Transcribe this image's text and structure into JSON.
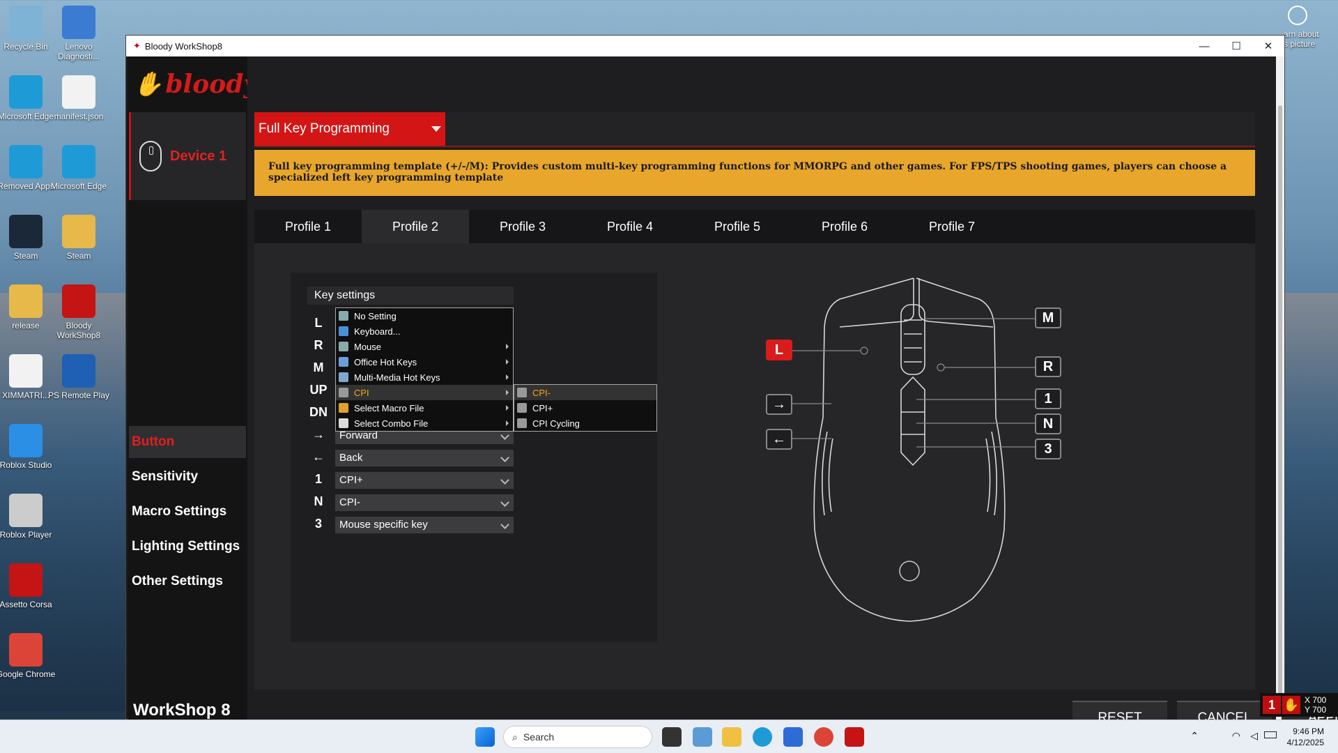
{
  "desktop": {
    "icons": [
      {
        "label": "Recycle Bin",
        "color": "#7fb3d6"
      },
      {
        "label": "Lenovo Diagnosti...",
        "color": "#3b7bd1"
      },
      {
        "label": "Microsoft Edge",
        "color": "#1e9bd7"
      },
      {
        "label": "manifest.json",
        "color": "#f2f2f2"
      },
      {
        "label": "Removed Apps",
        "color": "#1e9bd7"
      },
      {
        "label": "Microsoft Edge",
        "color": "#1e9bd7"
      },
      {
        "label": "Steam",
        "color": "#1b2838"
      },
      {
        "label": "Steam",
        "color": "#e6b94a"
      },
      {
        "label": "release",
        "color": "#e6b94a"
      },
      {
        "label": "Bloody WorkShop8",
        "color": "#c41414"
      },
      {
        "label": "XIMMATRI...",
        "color": "#f2f2f2"
      },
      {
        "label": "PS Remote Play",
        "color": "#1f5fb4"
      },
      {
        "label": "Roblox Studio",
        "color": "#2b8fe6"
      },
      {
        "label": "Roblox Player",
        "color": "#cccccc"
      },
      {
        "label": "Assetto Corsa",
        "color": "#c41414"
      },
      {
        "label": "Google Chrome",
        "color": "#db4437"
      }
    ],
    "learn_about": "arn about\ns picture"
  },
  "window": {
    "title": "Bloody WorkShop8",
    "min": "—",
    "max": "☐",
    "close": "✕"
  },
  "sidebar": {
    "logo": "bloody",
    "device": "Device 1",
    "nav": [
      {
        "label": "Button",
        "active": true
      },
      {
        "label": "Sensitivity",
        "active": false
      },
      {
        "label": "Macro Settings",
        "active": false
      },
      {
        "label": "Lighting Settings",
        "active": false
      },
      {
        "label": "Other Settings",
        "active": false
      }
    ],
    "footer": "WorkShop 8"
  },
  "mode": {
    "selected": "Full Key Programming",
    "notice": "Full key programming template (+/-/M): Provides custom multi-key programming functions for MMORPG and other games.  For FPS/TPS shooting games, players can choose a specialized left key programming template"
  },
  "profiles": [
    "Profile 1",
    "Profile 2",
    "Profile 3",
    "Profile 4",
    "Profile 5",
    "Profile 6",
    "Profile 7"
  ],
  "active_profile": "Profile 2",
  "key_settings": {
    "header": "Key settings",
    "rows": [
      {
        "key": "L",
        "value": ""
      },
      {
        "key": "R",
        "value": ""
      },
      {
        "key": "M",
        "value": ""
      },
      {
        "key": "UP",
        "value": ""
      },
      {
        "key": "DN",
        "value": ""
      },
      {
        "key": "→",
        "value": "Forward"
      },
      {
        "key": "←",
        "value": "Back"
      },
      {
        "key": "1",
        "value": "CPI+"
      },
      {
        "key": "N",
        "value": "CPI-"
      },
      {
        "key": "3",
        "value": "Mouse specific key"
      }
    ]
  },
  "context_menu": {
    "items": [
      {
        "label": "No Setting",
        "submenu": false
      },
      {
        "label": "Keyboard...",
        "submenu": false
      },
      {
        "label": "Mouse",
        "submenu": true
      },
      {
        "label": "Office Hot Keys",
        "submenu": true
      },
      {
        "label": "Multi-Media Hot Keys",
        "submenu": true
      },
      {
        "label": "CPI",
        "submenu": true,
        "highlight": true
      },
      {
        "label": "Select Macro File",
        "submenu": true
      },
      {
        "label": "Select Combo File",
        "submenu": true
      }
    ],
    "submenu": [
      {
        "label": "CPI-",
        "highlight": true
      },
      {
        "label": "CPI+"
      },
      {
        "label": "CPI Cycling"
      }
    ]
  },
  "mouse_callouts": {
    "L": "L",
    "M": "M",
    "R": "R",
    "one": "1",
    "N": "N",
    "three": "3",
    "forward": "→",
    "back": "←"
  },
  "actions": {
    "reset": "RESET",
    "cancel": "CANCEL",
    "apply": "APPLY"
  },
  "overlay": {
    "badge": "1",
    "x": "X 700",
    "y": "Y 700"
  },
  "taskbar": {
    "search": "Search",
    "time": "9:46 PM",
    "date": "4/12/2025"
  },
  "colors": {
    "accent": "#d31515",
    "notice": "#e8a62c",
    "menu_highlight": "#f5a623"
  }
}
